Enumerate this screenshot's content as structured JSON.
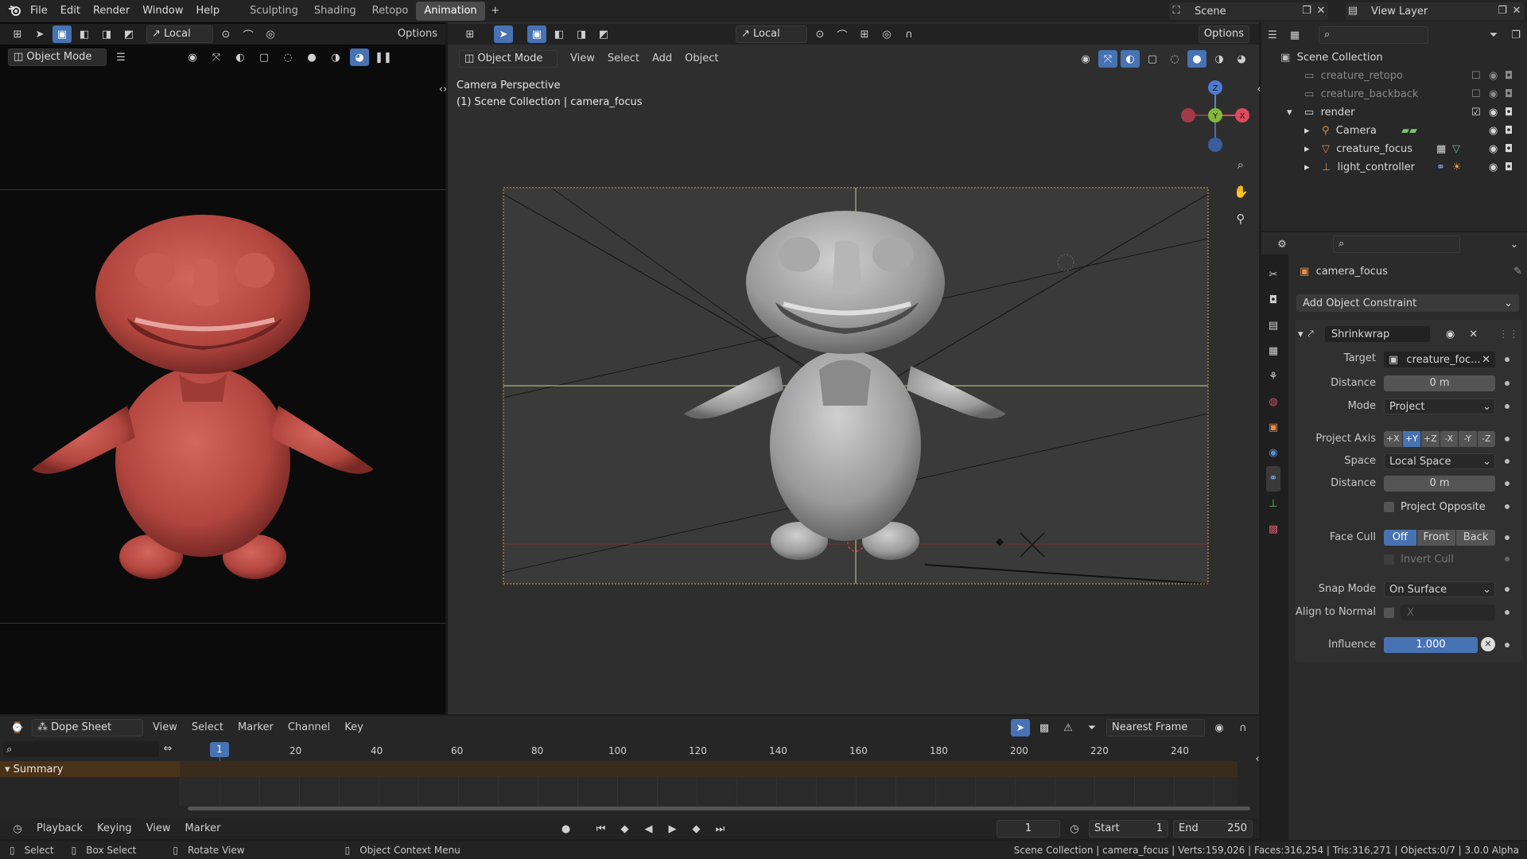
{
  "topbar": {
    "menus": [
      "File",
      "Edit",
      "Render",
      "Window",
      "Help"
    ],
    "workspaces": [
      "Sculpting",
      "Shading",
      "Retopo",
      "Animation"
    ],
    "active_workspace": "Animation",
    "scene_label": "Scene",
    "view_layer_label": "View Layer"
  },
  "left_viewport": {
    "mode": "Object Mode",
    "transform_orientation": "Local",
    "options_label": "Options"
  },
  "main_viewport": {
    "mode": "Object Mode",
    "menus": [
      "View",
      "Select",
      "Add",
      "Object"
    ],
    "transform_orientation": "Local",
    "options_label": "Options",
    "overlay_title": "Camera Perspective",
    "overlay_subtitle": "(1) Scene Collection | camera_focus",
    "gizmo": {
      "z": "Z",
      "y": "Y",
      "x": "X"
    }
  },
  "outliner": {
    "root": "Scene Collection",
    "rows": [
      {
        "label": "creature_retopo",
        "dim": true
      },
      {
        "label": "creature_backback",
        "dim": true
      },
      {
        "label": "render",
        "dim": false
      },
      {
        "label": "Camera",
        "dim": false
      },
      {
        "label": "creature_focus",
        "dim": false
      },
      {
        "label": "light_controller",
        "dim": false
      }
    ]
  },
  "properties": {
    "object_name": "camera_focus",
    "add_constraint_label": "Add Object Constraint",
    "constraint_name": "Shrinkwrap",
    "target_label": "Target",
    "target_value": "creature_foc...",
    "distance_label": "Distance",
    "distance_value": "0 m",
    "mode_label": "Mode",
    "mode_value": "Project",
    "project_axis_label": "Project Axis",
    "axes": [
      "+X",
      "+Y",
      "+Z",
      "-X",
      "-Y",
      "-Z"
    ],
    "active_axis": "+Y",
    "space_label": "Space",
    "space_value": "Local Space",
    "distance2_label": "Distance",
    "distance2_value": "0 m",
    "project_opposite_label": "Project Opposite",
    "face_cull_label": "Face Cull",
    "face_cull_options": [
      "Off",
      "Front",
      "Back"
    ],
    "face_cull_active": "Off",
    "invert_cull_label": "Invert Cull",
    "snap_mode_label": "Snap Mode",
    "snap_mode_value": "On Surface",
    "align_normal_label": "Align to Normal",
    "align_normal_axis": "X",
    "influence_label": "Influence",
    "influence_value": "1.000"
  },
  "dopesheet": {
    "editor_label": "Dope Sheet",
    "menus": [
      "View",
      "Select",
      "Marker",
      "Channel",
      "Key"
    ],
    "snap_label": "Nearest Frame",
    "summary_label": "Summary",
    "current_frame": "1",
    "ticks": [
      "20",
      "40",
      "60",
      "80",
      "100",
      "120",
      "140",
      "160",
      "180",
      "200",
      "220",
      "240"
    ]
  },
  "timeline": {
    "menus": [
      "Playback",
      "Keying",
      "View",
      "Marker"
    ],
    "frame": "1",
    "start_label": "Start",
    "start_value": "1",
    "end_label": "End",
    "end_value": "250"
  },
  "statusbar": {
    "select": "Select",
    "box_select": "Box Select",
    "rotate_view": "Rotate View",
    "context_menu": "Object Context Menu",
    "stats": "Scene Collection | camera_focus | Verts:159,026 | Faces:316,254 | Tris:316,271 | Objects:0/7 | 3.0.0 Alpha"
  },
  "colors": {
    "accent": "#4772b3",
    "creature_red": "#c0524b",
    "creature_grey": "#9a9a9a"
  }
}
